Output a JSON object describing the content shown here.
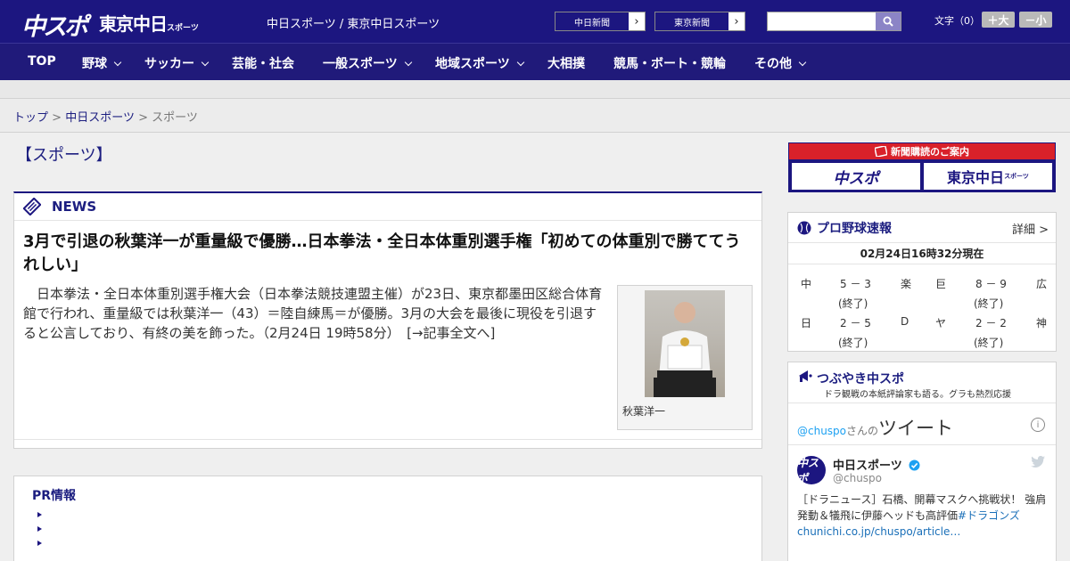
{
  "header": {
    "logo_chuspo": "中スポ",
    "logo_tokyo": "東京中日",
    "logo_tokyo_small": "スポーツ",
    "site_links": "中日スポーツ / 東京中日スポーツ",
    "paper_buttons": [
      {
        "label": "中日新聞",
        "arrow": "›"
      },
      {
        "label": "東京新聞",
        "arrow": "›"
      }
    ],
    "search_placeholder": "",
    "font_size_label": "文字（0）",
    "font_bigger": "＋大",
    "font_smaller": "－小"
  },
  "nav": {
    "items": [
      {
        "label": "TOP"
      },
      {
        "label": "野球"
      },
      {
        "label": "サッカー"
      },
      {
        "label": "芸能・社会"
      },
      {
        "label": "一般スポーツ"
      },
      {
        "label": "地域スポーツ"
      },
      {
        "label": "大相撲"
      },
      {
        "label": "競馬・ボート・競輪"
      },
      {
        "label": "その他"
      }
    ]
  },
  "breadcrumb": {
    "items": [
      "トップ",
      "中日スポーツ",
      "スポーツ"
    ],
    "separator": ">"
  },
  "section_title": "【スポーツ】",
  "news": {
    "label": "NEWS",
    "headline": "3月で引退の秋葉洋一が重量級で優勝…日本拳法・全日本体重別選手権「初めての体重別で勝ててうれしい」",
    "body": "日本拳法・全日本体重別選手権大会（日本拳法競技連盟主催）が23日、東京都墨田区総合体育館で行われ、重量級では秋葉洋一（43）＝陸自練馬＝が優勝。3月の大会を最後に現役を引退すると公言しており、有終の美を飾った。（2月24日 19時58分）　[→記事全文へ]",
    "photo_caption": "秋葉洋一"
  },
  "pr": {
    "title": "PR情報"
  },
  "sidebar": {
    "ad_top": "新聞購読のご案内",
    "ad_logo1": "中スポ",
    "ad_logo2": "東京中日",
    "ad_logo2_small": "スポーツ",
    "pro": {
      "title": "プロ野球速報",
      "detail": "詳細 >",
      "time": "02月24日16時32分現在",
      "games": [
        {
          "home": "中",
          "score": "5 － 3",
          "away": "楽",
          "status": "(終了)"
        },
        {
          "home": "巨",
          "score": "8 － 9",
          "away": "広",
          "status": "(終了)"
        },
        {
          "home": "日",
          "score": "2 － 5",
          "away": "D",
          "status": "(終了)"
        },
        {
          "home": "ヤ",
          "score": "2 － 2",
          "away": "神",
          "status": "(終了)"
        }
      ]
    },
    "tweets": {
      "title": "つぶやき中スポ",
      "subtitle": "ドラ観戦の本紙評論家も語る。グラも熱烈応援",
      "user_handle_link": "@chuspo",
      "user_suffix": "さんの",
      "user_tweet_word": "ツイート",
      "info": "i",
      "account_name": "中日スポーツ",
      "account_handle": "@chuspo",
      "avatar_text": "中スポ",
      "tweet_text": "［ドラニュース］石橋、開幕マスクへ挑戦状！ 強肩発動＆犠飛に伊藤ヘッドも高評価",
      "tweet_hashtag": "#ドラゴンズ",
      "tweet_link": "chunichi.co.jp/chuspo/article…"
    }
  },
  "colors": {
    "brand": "#1c1680",
    "accent_red": "#d9212a",
    "link": "#1c1e80",
    "twitter": "#1da1f2"
  }
}
